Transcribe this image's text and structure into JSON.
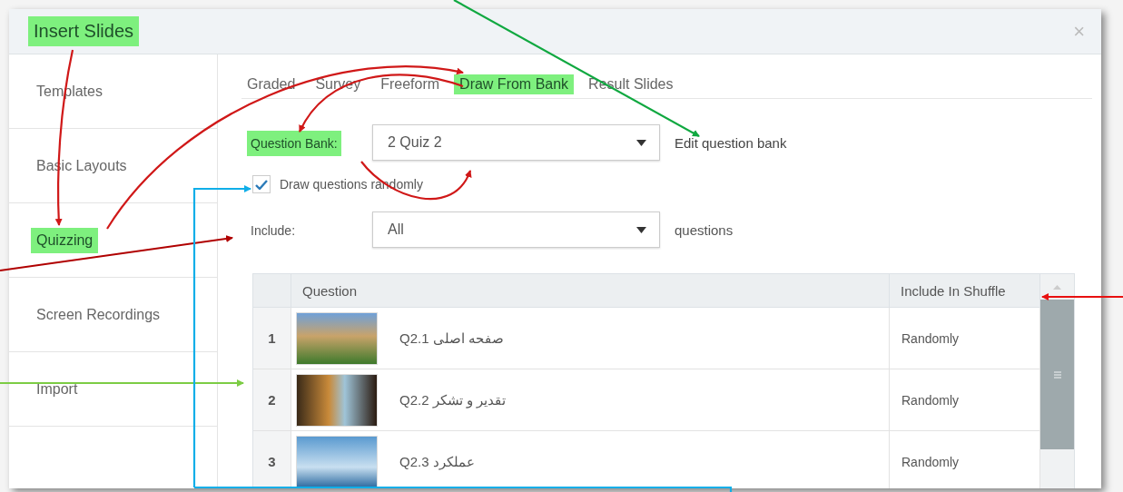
{
  "dialog": {
    "title": {
      "text": "Insert Slides",
      "highlighted": true
    },
    "close": "×"
  },
  "sidebar": {
    "items": [
      {
        "label": "Templates",
        "highlighted": false
      },
      {
        "label": "Basic Layouts",
        "highlighted": false
      },
      {
        "label": "Quizzing",
        "highlighted": true
      },
      {
        "label": "Screen Recordings",
        "highlighted": false
      },
      {
        "label": "Import",
        "highlighted": false
      }
    ]
  },
  "tabs": [
    {
      "label": "Graded",
      "highlighted": false
    },
    {
      "label": "Survey",
      "highlighted": false
    },
    {
      "label": "Freeform",
      "highlighted": false
    },
    {
      "label": "Draw From Bank",
      "highlighted": true
    },
    {
      "label": "Result Slides",
      "highlighted": false
    }
  ],
  "question_bank": {
    "label": "Question Bank:",
    "highlighted": true,
    "value": "2 Quiz 2",
    "link": "Edit question bank"
  },
  "draw_randomly": {
    "label": "Draw questions randomly",
    "checked": true
  },
  "include": {
    "label": "Include:",
    "value": "All",
    "suffix": "questions"
  },
  "table": {
    "columns": [
      "Question",
      "Include In Shuffle"
    ],
    "rows": [
      {
        "number": "1",
        "question": "Q2.1 صفحه اصلی",
        "shuffle": "Randomly"
      },
      {
        "number": "2",
        "question": "Q2.2 تقدیر و تشکر",
        "shuffle": "Randomly"
      },
      {
        "number": "3",
        "question": "Q2.3 عملکرد",
        "shuffle": "Randomly"
      }
    ]
  }
}
